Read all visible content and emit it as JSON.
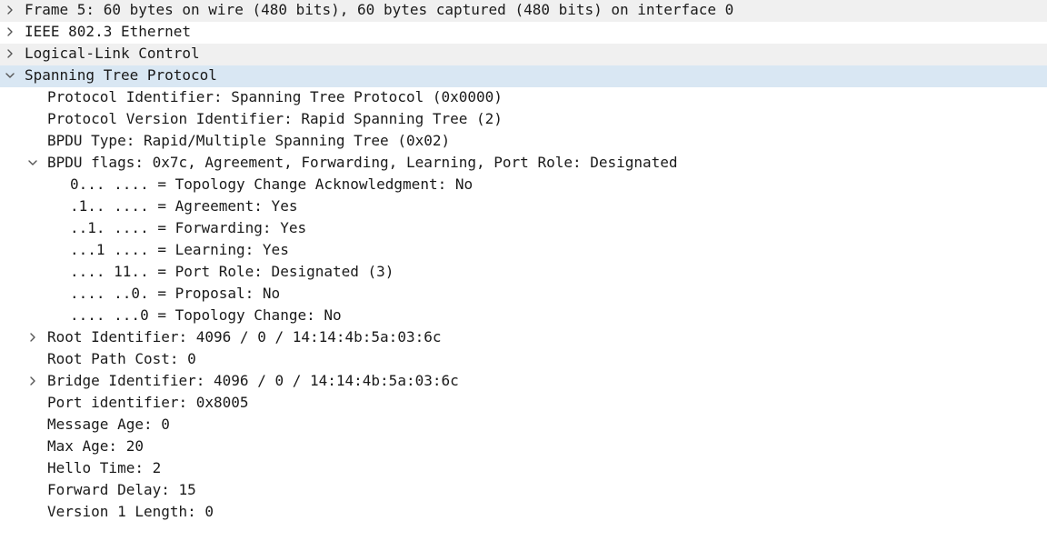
{
  "tree": {
    "rows": [
      {
        "name": "tree-row-frame",
        "text": "Frame 5: 60 bytes on wire (480 bits), 60 bytes captured (480 bits) on interface 0",
        "indent": 0,
        "toggle": "collapsed",
        "bg": "gray"
      },
      {
        "name": "tree-row-ieee-802-3",
        "text": "IEEE 802.3 Ethernet",
        "indent": 0,
        "toggle": "collapsed",
        "bg": "none"
      },
      {
        "name": "tree-row-llc",
        "text": "Logical-Link Control",
        "indent": 0,
        "toggle": "collapsed",
        "bg": "gray"
      },
      {
        "name": "tree-row-stp",
        "text": "Spanning Tree Protocol",
        "indent": 0,
        "toggle": "expanded",
        "bg": "selected"
      },
      {
        "name": "tree-row-protocol-identifier",
        "text": "Protocol Identifier: Spanning Tree Protocol (0x0000)",
        "indent": 1,
        "toggle": "none",
        "bg": "none"
      },
      {
        "name": "tree-row-protocol-version",
        "text": "Protocol Version Identifier: Rapid Spanning Tree (2)",
        "indent": 1,
        "toggle": "none",
        "bg": "none"
      },
      {
        "name": "tree-row-bpdu-type",
        "text": "BPDU Type: Rapid/Multiple Spanning Tree (0x02)",
        "indent": 1,
        "toggle": "none",
        "bg": "none"
      },
      {
        "name": "tree-row-bpdu-flags",
        "text": "BPDU flags: 0x7c, Agreement, Forwarding, Learning, Port Role: Designated",
        "indent": 1,
        "toggle": "expanded",
        "bg": "none"
      },
      {
        "name": "tree-row-flag-tca",
        "text": "0... .... = Topology Change Acknowledgment: No",
        "indent": 2,
        "toggle": "none",
        "bg": "none"
      },
      {
        "name": "tree-row-flag-agreement",
        "text": ".1.. .... = Agreement: Yes",
        "indent": 2,
        "toggle": "none",
        "bg": "none"
      },
      {
        "name": "tree-row-flag-forwarding",
        "text": "..1. .... = Forwarding: Yes",
        "indent": 2,
        "toggle": "none",
        "bg": "none"
      },
      {
        "name": "tree-row-flag-learning",
        "text": "...1 .... = Learning: Yes",
        "indent": 2,
        "toggle": "none",
        "bg": "none"
      },
      {
        "name": "tree-row-flag-port-role",
        "text": ".... 11.. = Port Role: Designated (3)",
        "indent": 2,
        "toggle": "none",
        "bg": "none"
      },
      {
        "name": "tree-row-flag-proposal",
        "text": ".... ..0. = Proposal: No",
        "indent": 2,
        "toggle": "none",
        "bg": "none"
      },
      {
        "name": "tree-row-flag-topology-change",
        "text": ".... ...0 = Topology Change: No",
        "indent": 2,
        "toggle": "none",
        "bg": "none"
      },
      {
        "name": "tree-row-root-identifier",
        "text": "Root Identifier: 4096 / 0 / 14:14:4b:5a:03:6c",
        "indent": 1,
        "toggle": "collapsed",
        "bg": "none"
      },
      {
        "name": "tree-row-root-path-cost",
        "text": "Root Path Cost: 0",
        "indent": 1,
        "toggle": "none",
        "bg": "none"
      },
      {
        "name": "tree-row-bridge-identifier",
        "text": "Bridge Identifier: 4096 / 0 / 14:14:4b:5a:03:6c",
        "indent": 1,
        "toggle": "collapsed",
        "bg": "none"
      },
      {
        "name": "tree-row-port-identifier",
        "text": "Port identifier: 0x8005",
        "indent": 1,
        "toggle": "none",
        "bg": "none"
      },
      {
        "name": "tree-row-message-age",
        "text": "Message Age: 0",
        "indent": 1,
        "toggle": "none",
        "bg": "none"
      },
      {
        "name": "tree-row-max-age",
        "text": "Max Age: 20",
        "indent": 1,
        "toggle": "none",
        "bg": "none"
      },
      {
        "name": "tree-row-hello-time",
        "text": "Hello Time: 2",
        "indent": 1,
        "toggle": "none",
        "bg": "none"
      },
      {
        "name": "tree-row-forward-delay",
        "text": "Forward Delay: 15",
        "indent": 1,
        "toggle": "none",
        "bg": "none"
      },
      {
        "name": "tree-row-version-1-length",
        "text": "Version 1 Length: 0",
        "indent": 1,
        "toggle": "none",
        "bg": "none"
      }
    ]
  },
  "colors": {
    "text": "#1a1a1a",
    "row_alt_bg": "#f0f0f0",
    "selected_bg": "#d9e7f3",
    "chevron": "#555555"
  },
  "icons": {
    "collapsed": "chevron-right-icon",
    "expanded": "chevron-down-icon"
  }
}
